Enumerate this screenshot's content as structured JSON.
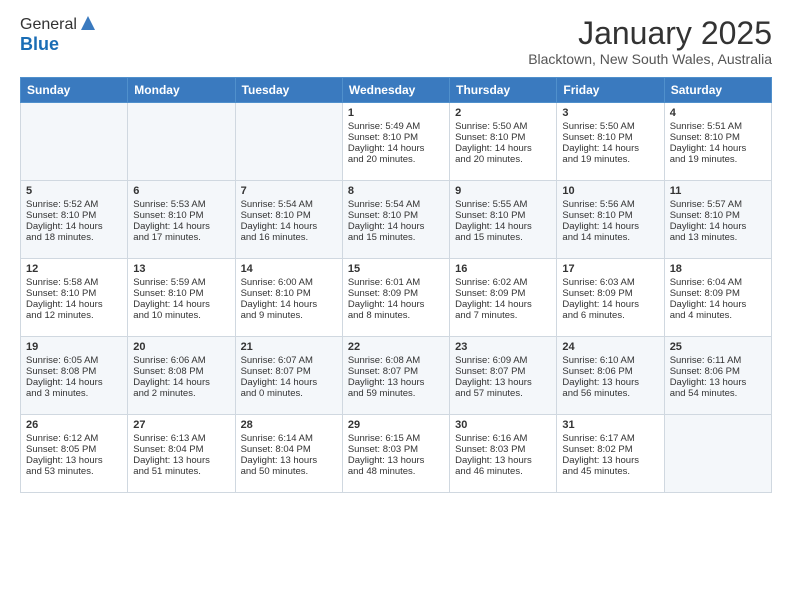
{
  "logo": {
    "general": "General",
    "blue": "Blue"
  },
  "header": {
    "title": "January 2025",
    "subtitle": "Blacktown, New South Wales, Australia"
  },
  "days_of_week": [
    "Sunday",
    "Monday",
    "Tuesday",
    "Wednesday",
    "Thursday",
    "Friday",
    "Saturday"
  ],
  "weeks": [
    [
      {
        "day": "",
        "content": ""
      },
      {
        "day": "",
        "content": ""
      },
      {
        "day": "",
        "content": ""
      },
      {
        "day": "1",
        "content": "Sunrise: 5:49 AM\nSunset: 8:10 PM\nDaylight: 14 hours\nand 20 minutes."
      },
      {
        "day": "2",
        "content": "Sunrise: 5:50 AM\nSunset: 8:10 PM\nDaylight: 14 hours\nand 20 minutes."
      },
      {
        "day": "3",
        "content": "Sunrise: 5:50 AM\nSunset: 8:10 PM\nDaylight: 14 hours\nand 19 minutes."
      },
      {
        "day": "4",
        "content": "Sunrise: 5:51 AM\nSunset: 8:10 PM\nDaylight: 14 hours\nand 19 minutes."
      }
    ],
    [
      {
        "day": "5",
        "content": "Sunrise: 5:52 AM\nSunset: 8:10 PM\nDaylight: 14 hours\nand 18 minutes."
      },
      {
        "day": "6",
        "content": "Sunrise: 5:53 AM\nSunset: 8:10 PM\nDaylight: 14 hours\nand 17 minutes."
      },
      {
        "day": "7",
        "content": "Sunrise: 5:54 AM\nSunset: 8:10 PM\nDaylight: 14 hours\nand 16 minutes."
      },
      {
        "day": "8",
        "content": "Sunrise: 5:54 AM\nSunset: 8:10 PM\nDaylight: 14 hours\nand 15 minutes."
      },
      {
        "day": "9",
        "content": "Sunrise: 5:55 AM\nSunset: 8:10 PM\nDaylight: 14 hours\nand 15 minutes."
      },
      {
        "day": "10",
        "content": "Sunrise: 5:56 AM\nSunset: 8:10 PM\nDaylight: 14 hours\nand 14 minutes."
      },
      {
        "day": "11",
        "content": "Sunrise: 5:57 AM\nSunset: 8:10 PM\nDaylight: 14 hours\nand 13 minutes."
      }
    ],
    [
      {
        "day": "12",
        "content": "Sunrise: 5:58 AM\nSunset: 8:10 PM\nDaylight: 14 hours\nand 12 minutes."
      },
      {
        "day": "13",
        "content": "Sunrise: 5:59 AM\nSunset: 8:10 PM\nDaylight: 14 hours\nand 10 minutes."
      },
      {
        "day": "14",
        "content": "Sunrise: 6:00 AM\nSunset: 8:10 PM\nDaylight: 14 hours\nand 9 minutes."
      },
      {
        "day": "15",
        "content": "Sunrise: 6:01 AM\nSunset: 8:09 PM\nDaylight: 14 hours\nand 8 minutes."
      },
      {
        "day": "16",
        "content": "Sunrise: 6:02 AM\nSunset: 8:09 PM\nDaylight: 14 hours\nand 7 minutes."
      },
      {
        "day": "17",
        "content": "Sunrise: 6:03 AM\nSunset: 8:09 PM\nDaylight: 14 hours\nand 6 minutes."
      },
      {
        "day": "18",
        "content": "Sunrise: 6:04 AM\nSunset: 8:09 PM\nDaylight: 14 hours\nand 4 minutes."
      }
    ],
    [
      {
        "day": "19",
        "content": "Sunrise: 6:05 AM\nSunset: 8:08 PM\nDaylight: 14 hours\nand 3 minutes."
      },
      {
        "day": "20",
        "content": "Sunrise: 6:06 AM\nSunset: 8:08 PM\nDaylight: 14 hours\nand 2 minutes."
      },
      {
        "day": "21",
        "content": "Sunrise: 6:07 AM\nSunset: 8:07 PM\nDaylight: 14 hours\nand 0 minutes."
      },
      {
        "day": "22",
        "content": "Sunrise: 6:08 AM\nSunset: 8:07 PM\nDaylight: 13 hours\nand 59 minutes."
      },
      {
        "day": "23",
        "content": "Sunrise: 6:09 AM\nSunset: 8:07 PM\nDaylight: 13 hours\nand 57 minutes."
      },
      {
        "day": "24",
        "content": "Sunrise: 6:10 AM\nSunset: 8:06 PM\nDaylight: 13 hours\nand 56 minutes."
      },
      {
        "day": "25",
        "content": "Sunrise: 6:11 AM\nSunset: 8:06 PM\nDaylight: 13 hours\nand 54 minutes."
      }
    ],
    [
      {
        "day": "26",
        "content": "Sunrise: 6:12 AM\nSunset: 8:05 PM\nDaylight: 13 hours\nand 53 minutes."
      },
      {
        "day": "27",
        "content": "Sunrise: 6:13 AM\nSunset: 8:04 PM\nDaylight: 13 hours\nand 51 minutes."
      },
      {
        "day": "28",
        "content": "Sunrise: 6:14 AM\nSunset: 8:04 PM\nDaylight: 13 hours\nand 50 minutes."
      },
      {
        "day": "29",
        "content": "Sunrise: 6:15 AM\nSunset: 8:03 PM\nDaylight: 13 hours\nand 48 minutes."
      },
      {
        "day": "30",
        "content": "Sunrise: 6:16 AM\nSunset: 8:03 PM\nDaylight: 13 hours\nand 46 minutes."
      },
      {
        "day": "31",
        "content": "Sunrise: 6:17 AM\nSunset: 8:02 PM\nDaylight: 13 hours\nand 45 minutes."
      },
      {
        "day": "",
        "content": ""
      }
    ]
  ]
}
